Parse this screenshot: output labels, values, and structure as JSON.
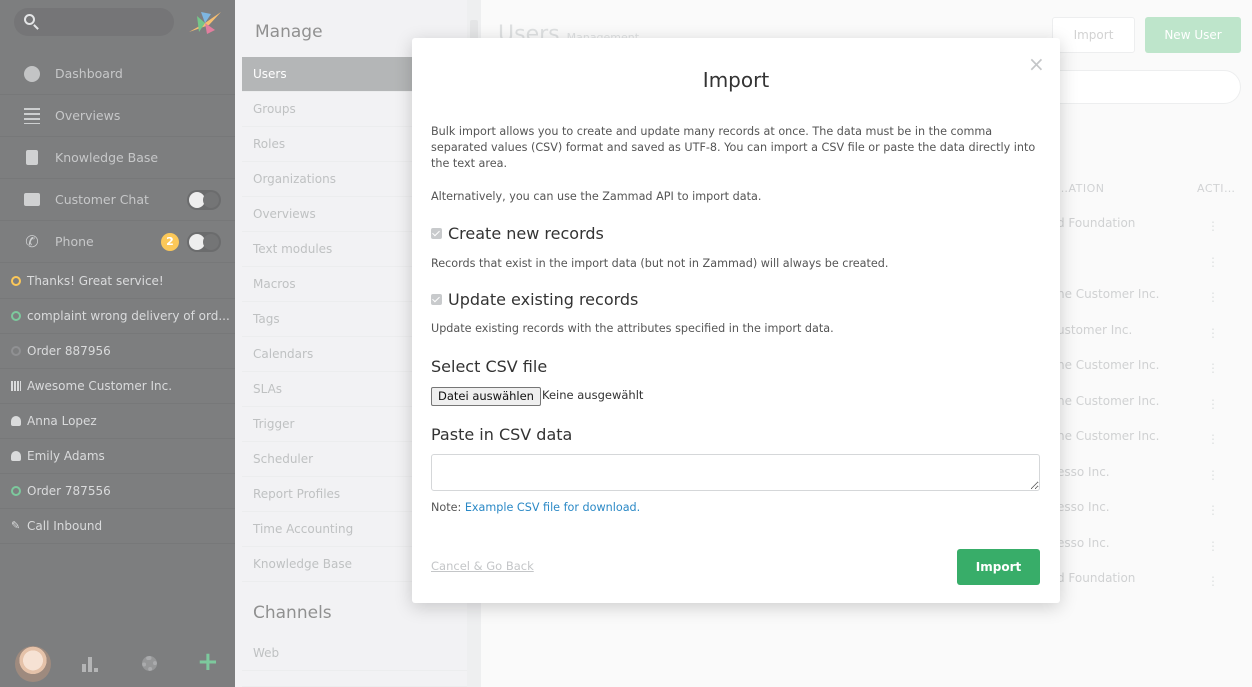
{
  "nav": {
    "items": [
      {
        "label": "Dashboard",
        "icon": "dashboard-icon"
      },
      {
        "label": "Overviews",
        "icon": "overviews-icon"
      },
      {
        "label": "Knowledge Base",
        "icon": "knowledge-base-icon"
      },
      {
        "label": "Customer Chat",
        "icon": "chat-icon"
      },
      {
        "label": "Phone",
        "icon": "phone-icon",
        "badge": "2"
      }
    ],
    "tasks": [
      {
        "label": "Thanks! Great service!",
        "icon": "ticket-pending-icon"
      },
      {
        "label": "complaint wrong delivery of ord...",
        "icon": "ticket-open-icon"
      },
      {
        "label": "Order 887956",
        "icon": "ticket-closed-icon"
      },
      {
        "label": "Awesome Customer Inc.",
        "icon": "organization-icon"
      },
      {
        "label": "Anna Lopez",
        "icon": "user-icon"
      },
      {
        "label": "Emily Adams",
        "icon": "user-icon"
      },
      {
        "label": "Order 787556",
        "icon": "ticket-open-icon"
      },
      {
        "label": "Call Inbound",
        "icon": "pencil-icon"
      }
    ]
  },
  "manage": {
    "heading": "Manage",
    "links": [
      "Users",
      "Groups",
      "Roles",
      "Organizations",
      "Overviews",
      "Text modules",
      "Macros",
      "Tags",
      "Calendars",
      "SLAs",
      "Trigger",
      "Scheduler",
      "Report Profiles",
      "Time Accounting",
      "Knowledge Base"
    ],
    "active": "Users",
    "channels_heading": "Channels",
    "channel_links": [
      "Web"
    ]
  },
  "content": {
    "title": "Users",
    "subtitle": "Management",
    "import_button": "Import",
    "new_user_button": "New User",
    "columns": {
      "organization": "…ATION",
      "actions": "ACTI…"
    },
    "rows": [
      "d Foundation",
      "",
      "he Customer Inc.",
      "ustomer Inc.",
      "he Customer Inc.",
      "he Customer Inc.",
      "he Customer Inc.",
      "esso Inc.",
      "esso Inc.",
      "esso Inc.",
      "d Foundation"
    ],
    "row_action": "⋮"
  },
  "modal": {
    "title": "Import",
    "intro": "Bulk import allows you to create and update many records at once. The data must be in the comma separated values (CSV) format and saved as UTF-8. You can import a CSV file or paste the data directly into the text area.",
    "api_note": "Alternatively, you can use the Zammad API to import data.",
    "create_label": "Create new records",
    "create_help": "Records that exist in the import data (but not in Zammad) will always be created.",
    "update_label": "Update existing records",
    "update_help": "Update existing records with the attributes specified in the import data.",
    "select_heading": "Select CSV file",
    "file_button": "Datei auswählen",
    "file_status": "Keine ausgewählt",
    "paste_heading": "Paste in CSV data",
    "textarea_value": "",
    "note_prefix": "Note: ",
    "note_link": "Example CSV file for download.",
    "cancel": "Cancel & Go Back",
    "submit": "Import",
    "close_symbol": "×"
  },
  "colors": {
    "accent_green": "#38ad69",
    "badge_orange": "#faab00",
    "link_blue": "#2b89c6",
    "nav_bg": "#38393b"
  }
}
